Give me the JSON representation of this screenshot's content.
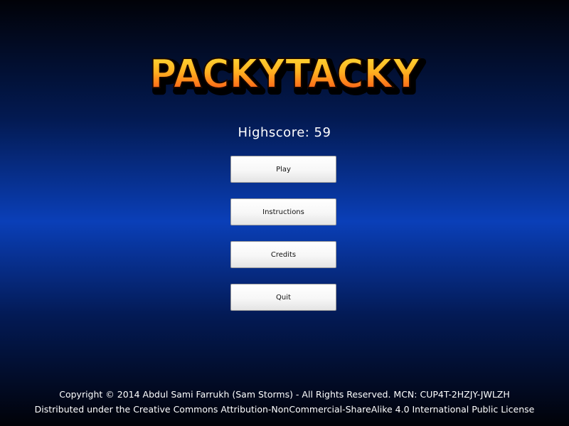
{
  "game": {
    "logo_text": "PACKYTACKY",
    "highscore_text": "Highscore: 59"
  },
  "menu": {
    "items": [
      {
        "label": "Play"
      },
      {
        "label": "Instructions"
      },
      {
        "label": "Credits"
      },
      {
        "label": "Quit"
      }
    ]
  },
  "footer": {
    "copyright": "Copyright © 2014 Abdul Sami Farrukh (Sam Storms) - All Rights Reserved. MCN: CUP4T-2HZJY-JWLZH",
    "license": "Distributed under the Creative Commons Attribution-NonCommercial-ShareAlike 4.0 International Public License"
  },
  "colors": {
    "logo_top": "#ffe33a",
    "logo_bottom": "#ff3c14",
    "logo_shadow": "#000000",
    "background_center": "#0a3fb8",
    "background_edge": "#010208"
  }
}
